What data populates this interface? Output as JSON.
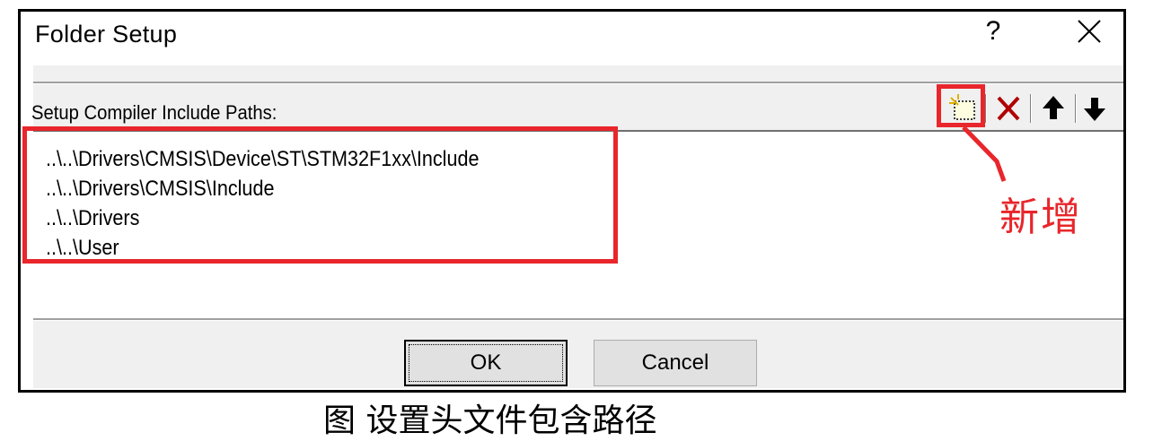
{
  "dialog": {
    "title": "Folder Setup",
    "help_label": "?",
    "section_label": "Setup Compiler Include Paths:",
    "paths": [
      "..\\..\\Drivers\\CMSIS\\Device\\ST\\STM32F1xx\\Include",
      "..\\..\\Drivers\\CMSIS\\Include",
      "..\\..\\Drivers",
      "..\\..\\User"
    ],
    "toolbar": {
      "new_icon": "new-folder-icon",
      "delete_icon": "delete-x-icon",
      "up_icon": "arrow-up-icon",
      "down_icon": "arrow-down-icon"
    },
    "ok_label": "OK",
    "cancel_label": "Cancel"
  },
  "annotation": {
    "text": "新增",
    "color": "#e8262b"
  },
  "caption": "图          设置头文件包含路径"
}
